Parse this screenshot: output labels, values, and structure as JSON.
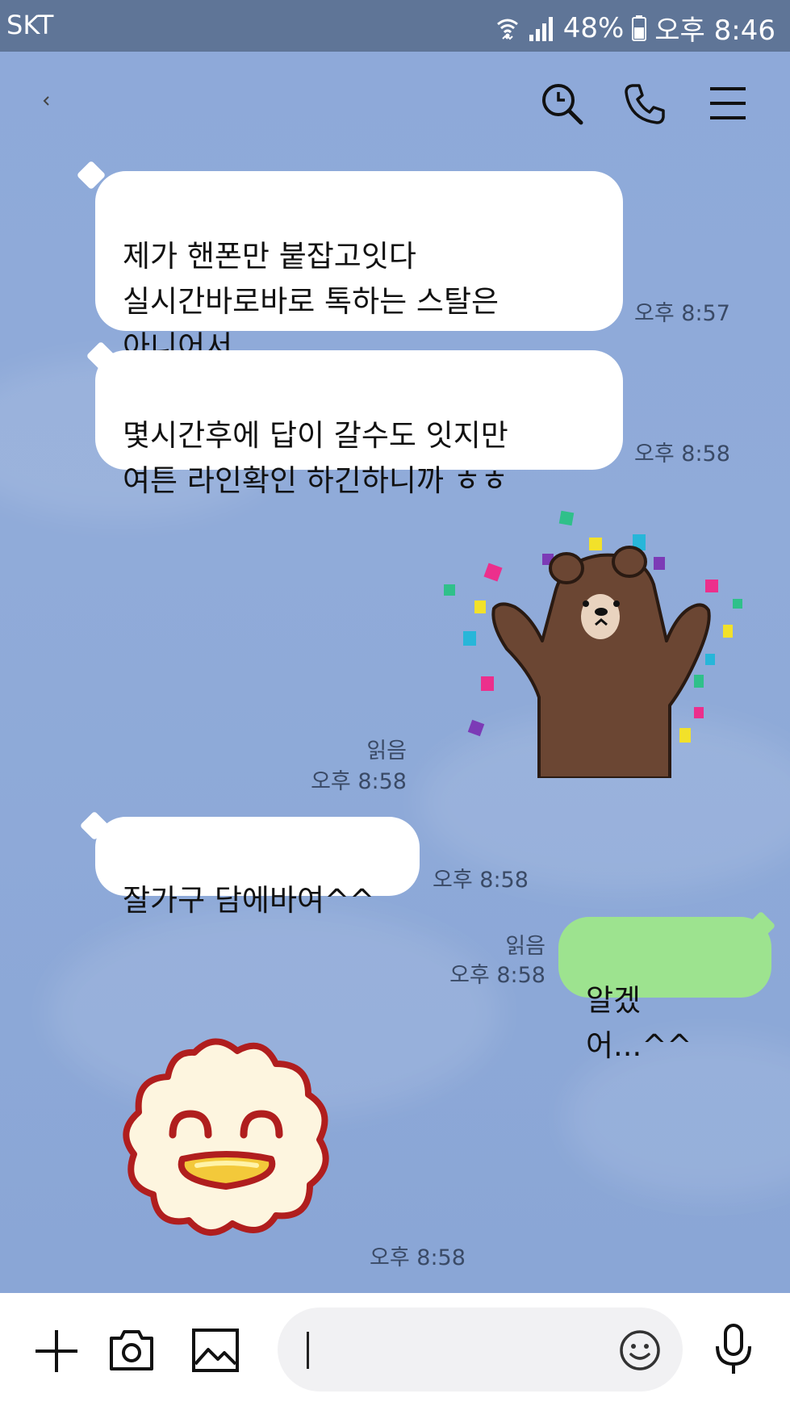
{
  "status_bar": {
    "carrier": "SKT",
    "battery": "48%",
    "time": "오후 8:46"
  },
  "header": {
    "back_icon": "chevron-left-icon",
    "search_icon": "search-icon",
    "call_icon": "phone-icon",
    "menu_icon": "menu-icon"
  },
  "messages": [
    {
      "from": "other",
      "text": "제가 핸폰만 붙잡고잇다\n실시간바로바로 톡하는 스탈은\n아니어서",
      "time": "오후 8:57"
    },
    {
      "from": "other",
      "text": "몇시간후에 답이 갈수도 잇지만\n여튼 라인확인 하긴하니까 ㅎㅎ",
      "time": "오후 8:58"
    },
    {
      "from": "me",
      "type": "sticker",
      "sticker": "brown-bear-cheering-sticker",
      "read": "읽음",
      "time": "오후 8:58"
    },
    {
      "from": "other",
      "text": "잘가구 담에바여^^",
      "time": "오후 8:58"
    },
    {
      "from": "me",
      "text": "알겠어...^^",
      "read": "읽음",
      "time": "오후 8:58"
    },
    {
      "from": "other",
      "type": "sticker",
      "sticker": "smiling-cloud-sticker",
      "time": "오후 8:58"
    }
  ],
  "input_bar": {
    "plus_icon": "plus-icon",
    "camera_icon": "camera-icon",
    "image_icon": "image-icon",
    "emoji_icon": "emoji-icon",
    "mic_icon": "microphone-icon",
    "input_value": ""
  },
  "colors": {
    "status_bar": "#5f7597",
    "chat_bg": "#8eaad8",
    "incoming_bubble": "#ffffff",
    "outgoing_bubble": "#9de38f"
  }
}
